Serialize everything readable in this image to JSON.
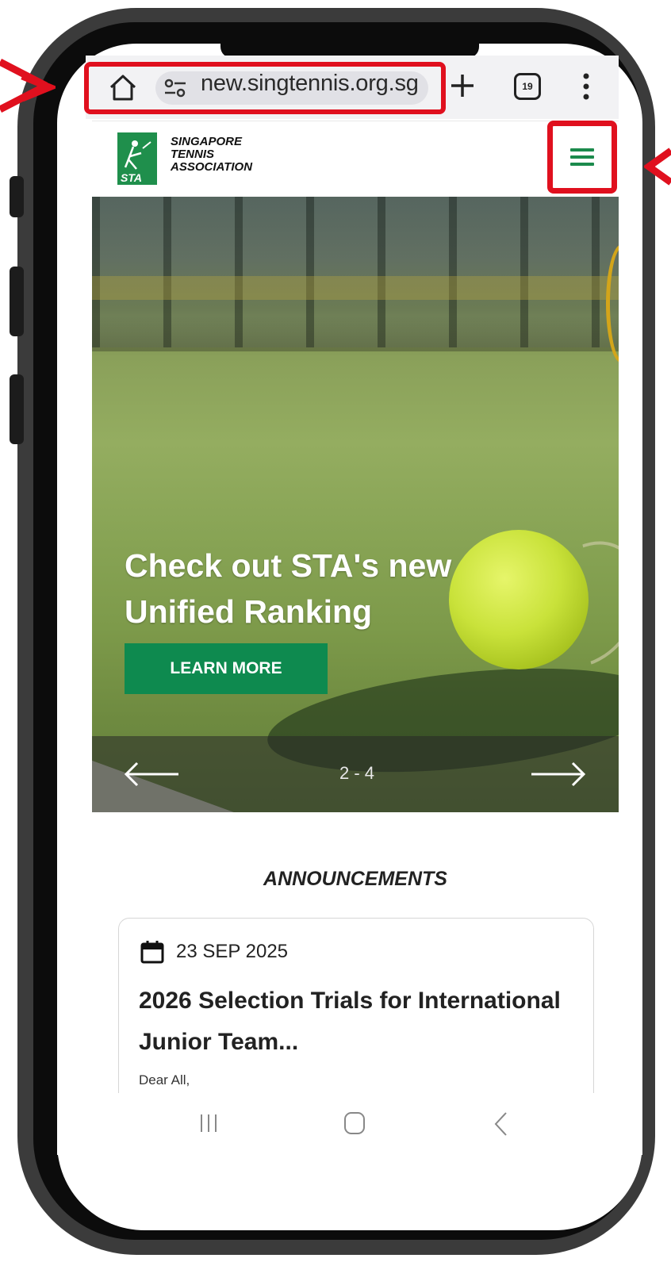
{
  "browser": {
    "url": "new.singtennis.org.sg",
    "tab_count": "19"
  },
  "site": {
    "logo_text_line1": "SINGAPORE",
    "logo_text_line2": "TENNIS",
    "logo_text_line3": "ASSOCIATION",
    "logo_mark_text": "STA",
    "brand_color": "#0e8a4f"
  },
  "hero": {
    "title": "Check out STA's new Unified Ranking",
    "button_label": "LEARN MORE",
    "slide_counter": "2 - 4"
  },
  "announcements": {
    "heading": "ANNOUNCEMENTS",
    "items": [
      {
        "date": "23 SEP 2025",
        "title": "2026 Selection Trials for International Junior Team...",
        "body": "Dear All,"
      }
    ]
  },
  "annotation_color": "#e0101e",
  "icons": [
    "home-icon",
    "site-settings-icon",
    "new-tab-icon",
    "tab-switcher-icon",
    "more-menu-icon",
    "hamburger-menu-icon",
    "arrow-left-icon",
    "arrow-right-icon",
    "calendar-icon",
    "nav-recents-icon",
    "nav-home-icon",
    "nav-back-icon"
  ]
}
